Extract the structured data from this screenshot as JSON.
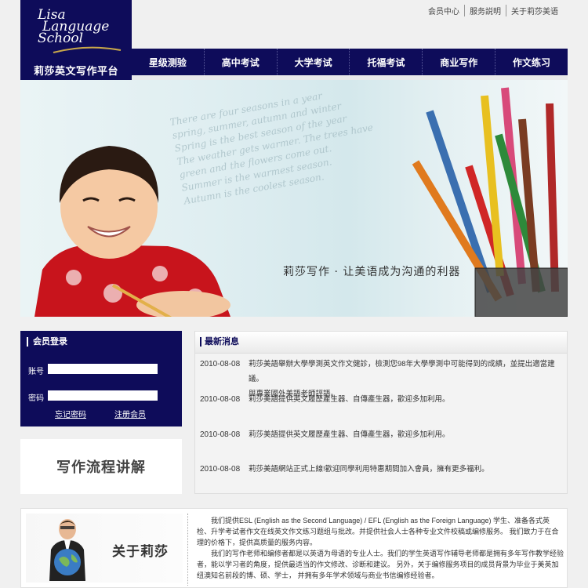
{
  "logo": {
    "script_line1": "Lisa",
    "script_line2": "Language",
    "script_line3": "School",
    "subtitle": "莉莎英文写作平台"
  },
  "top_links": [
    "会员中心",
    "服务説明",
    "关于莉莎美语"
  ],
  "nav": [
    "星级测验",
    "高中考试",
    "大学考试",
    "托福考试",
    "商业写作",
    "作文练习"
  ],
  "banner": {
    "tagline": "莉莎写作 · 让美语成为沟通的利器",
    "handwriting": [
      "There are four seasons in a year",
      "spring, summer, autumn and winter",
      "Spring is the best season of the year",
      "The weather gets warmer. The trees have",
      "green and the flowers come out.",
      "Summer is the warmest season.",
      "Autumn is the coolest season."
    ]
  },
  "login": {
    "title": "会员登录",
    "account_label": "账号",
    "password_label": "密码",
    "forgot_link": "忘记密码",
    "register_link": "注册会员"
  },
  "flow_box": {
    "label": "写作流程讲解"
  },
  "news": {
    "title": "最新消息",
    "items": [
      {
        "date": "2010-08-08",
        "text": "莉莎美語舉辦大學學測英文作文健診，檢測您98年大學學測中可能得到的成績，並提出適當建議。",
        "text2": "與專業國外美語老師評語。"
      },
      {
        "date": "2010-08-08",
        "text": "莉莎美語提供英文履歷產生器、自傳產生器，歡迎多加利用。"
      },
      {
        "date": "2010-08-08",
        "text": "莉莎美語提供英文履歷產生器、自傳產生器，歡迎多加利用。"
      },
      {
        "date": "2010-08-08",
        "text": "莉莎美語網站正式上線!歡迎同學利用特惠期間加入會員，擁有更多福利。"
      }
    ]
  },
  "about": {
    "heading": "关于莉莎",
    "paragraph1": "我们提供ESL (English as the Second Language) / EFL (English as the Foreign Language) 学生、准备各式英检、升学考试者作文在线英文作文练习题组与批改。并提供社会人士各种专业文件校稿或编修服务。 我们致力于在合理的价格下，提供高质量的服务内容。",
    "paragraph2": "我们的写作老师和编修者都是以英语为母语的专业人士。我们的学生英语写作辅导老师都是拥有多年写作教学经验者，能以学习者的角度，提供最适当的作文修改、诊断和建议。 另外，关于编修服务项目的成员背景为毕业于美英加纽澳知名前段的博、硕、学士， 并拥有多年学术领域与商业书信编修经验者。"
  },
  "colors": {
    "brand_navy": "#0e0c5a",
    "background": "#f0f0f0"
  }
}
